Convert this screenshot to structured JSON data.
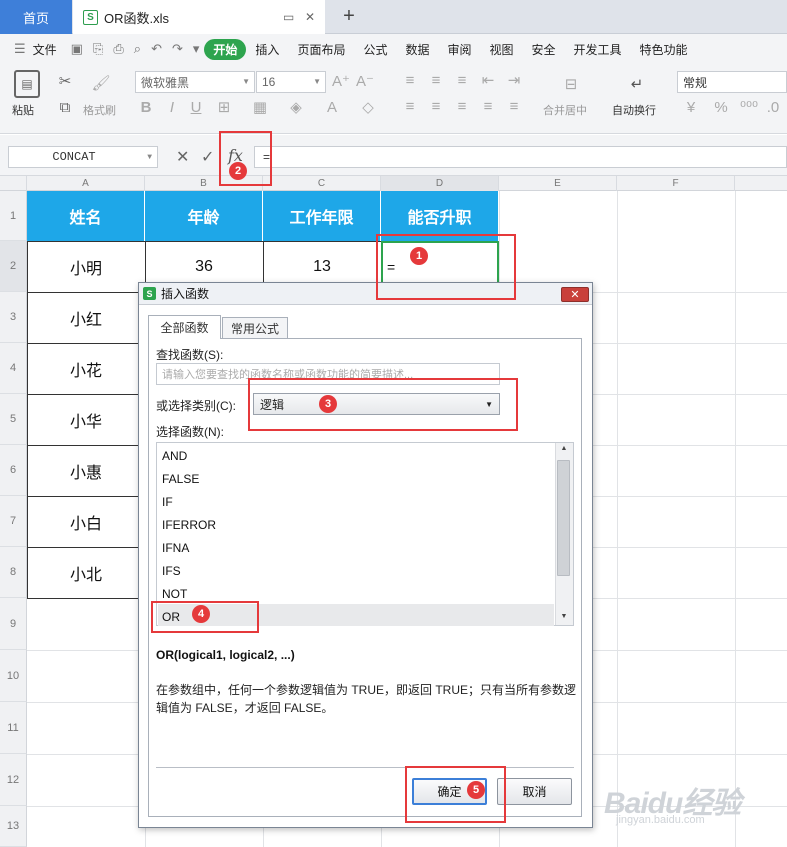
{
  "tabs": {
    "home": "首页",
    "doc": "OR函数.xls"
  },
  "menu": {
    "file": "文件",
    "items": [
      "开始",
      "插入",
      "页面布局",
      "公式",
      "数据",
      "审阅",
      "视图",
      "安全",
      "开发工具",
      "特色功能"
    ],
    "active_index": 0
  },
  "toolbar": {
    "paste": "粘贴",
    "format_painter": "格式刷",
    "font_name": "微软雅黑",
    "font_size": "16",
    "merge": "合并居中",
    "wrap": "自动换行",
    "number_format": "常规"
  },
  "formula_bar": {
    "name_box": "CONCAT",
    "fx": "fx",
    "content": "="
  },
  "columns": [
    "A",
    "B",
    "C",
    "D",
    "E",
    "F"
  ],
  "rows": [
    "1",
    "2",
    "3",
    "4",
    "5",
    "6",
    "7",
    "8",
    "9",
    "10",
    "11",
    "12",
    "13"
  ],
  "table": {
    "headers": [
      "姓名",
      "年龄",
      "工作年限",
      "能否升职"
    ],
    "names": [
      "小明",
      "小红",
      "小花",
      "小华",
      "小惠",
      "小白",
      "小北"
    ],
    "row2": {
      "age": "36",
      "years": "13",
      "formula": "="
    }
  },
  "dialog": {
    "title": "插入函数",
    "tab_all": "全部函数",
    "tab_common": "常用公式",
    "search_label": "查找函数(S):",
    "search_placeholder": "请输入您要查找的函数名称或函数功能的简要描述...",
    "category_label": "或选择类别(C):",
    "category_value": "逻辑",
    "select_label": "选择函数(N):",
    "functions": [
      "AND",
      "FALSE",
      "IF",
      "IFERROR",
      "IFNA",
      "IFS",
      "NOT",
      "OR"
    ],
    "selected_function": "OR",
    "signature": "OR(logical1, logical2, ...)",
    "description": "在参数组中，任何一个参数逻辑值为 TRUE，即返回 TRUE；只有当所有参数逻辑值为 FALSE，才返回 FALSE。",
    "ok": "确定",
    "cancel": "取消"
  },
  "annotations": [
    "1",
    "2",
    "3",
    "4",
    "5"
  ],
  "accent_color": "#e5393b",
  "header_fill": "#1ea7e8",
  "watermark": {
    "main": "Baidu经验",
    "sub": "jingyan.baidu.com"
  }
}
